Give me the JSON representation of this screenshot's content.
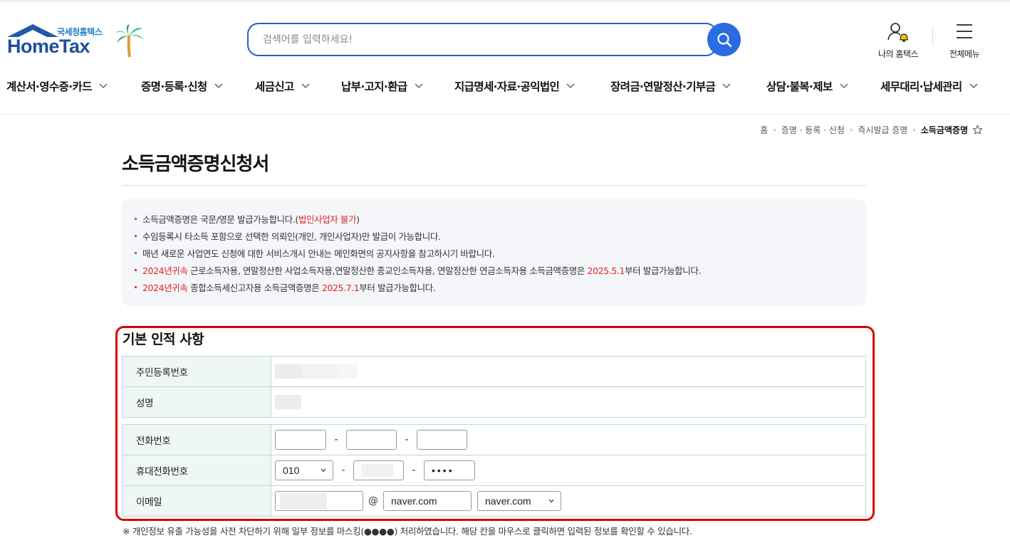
{
  "header": {
    "logo_sub": "국세청홈택스",
    "logo_main": "HomeTax",
    "search_placeholder": "검색어를 입력하세요!",
    "my_hometax": "나의 홈택스",
    "all_menu": "전체메뉴"
  },
  "gnb": [
    {
      "label": "계산서·영수증·카드"
    },
    {
      "label": "증명·등록·신청"
    },
    {
      "label": "세금신고"
    },
    {
      "label": "납부·고지·환급"
    },
    {
      "label": "지급명세·자료·공익법인"
    },
    {
      "label": "장려금·연말정산·기부금"
    },
    {
      "label": "상담·불복·제보"
    },
    {
      "label": "세무대리·납세관리"
    }
  ],
  "breadcrumb": [
    "홈",
    "증명 · 등록 · 신청",
    "즉시발급 증명",
    "소득금액증명"
  ],
  "page_title": "소득금액증명신청서",
  "notice": {
    "line1_a": "소득금액증명은 국문/영문 발급가능합니다.(",
    "line1_red": "법인사업자 불가",
    "line1_b": ")",
    "line2": "수임등록시 타소득 포함으로 선택한 의뢰인(개인, 개인사업자)만 발급이 가능합니다.",
    "line3": "매년 새로운 사업연도 신청에 대한 서비스개시 안내는 메인화면의 공지사항을 참고하시기 바랍니다.",
    "line4_red1": "2024년귀속",
    "line4_a": " 근로소득자용, 연말정산한 사업소득자용,연말정산한 종교인소득자용, 연말정산한 연금소득자용 소득금액증명은 ",
    "line4_red2": "2025.5.1",
    "line4_b": "부터 발급가능합니다.",
    "line5_red1": "2024년귀속",
    "line5_a": " 종합소득세신고자용 소득금액증명은 ",
    "line5_red2": "2025.7.1",
    "line5_b": "부터 발급가능합니다."
  },
  "section": {
    "title": "기본 인적 사항",
    "labels": {
      "rrn": "주민등록번호",
      "name": "성명",
      "phone": "전화번호",
      "mobile": "휴대전화번호",
      "email": "이메일"
    },
    "phone": {
      "part1": "",
      "part2": "",
      "part3": ""
    },
    "mobile": {
      "prefix": "010",
      "middle": "",
      "last": "••••"
    },
    "email": {
      "id": "",
      "at": "@",
      "domain": "naver.com",
      "domain_select": "naver.com"
    },
    "dash": "-"
  },
  "footnote": "※ 개인정보 유출 가능성을 사전 차단하기 위해 일부 정보를 마스킹(●●●●) 처리하였습니다. 해당 칸을 마우스로 클릭하면 입력된 정보를 확인할 수 있습니다.",
  "colors": {
    "primary": "#2a6de3",
    "highlight_frame": "#d8000c",
    "notice_red": "#e02424",
    "th_bg": "#eef7f6"
  }
}
